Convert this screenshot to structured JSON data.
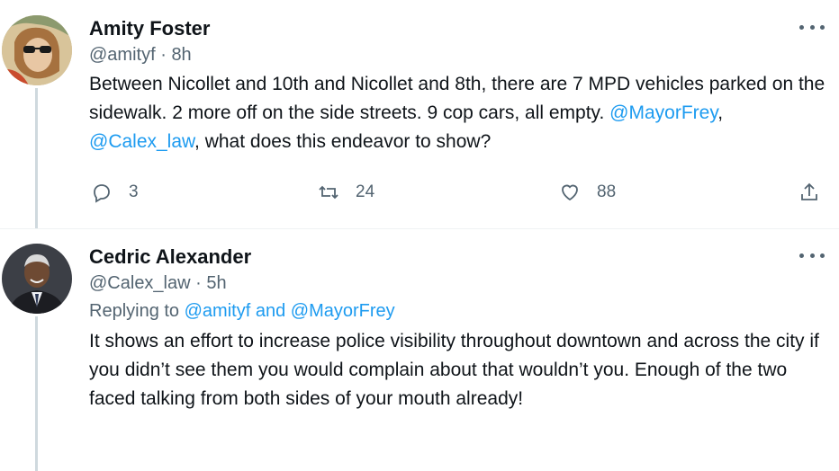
{
  "tweets": [
    {
      "name": "Amity Foster",
      "handle": "@amityf",
      "separator": "·",
      "time": "8h",
      "text_parts": [
        "Between Nicollet and 10th and Nicollet and 8th, there are 7 MPD vehicles parked on the sidewalk. 2 more off on the side streets. 9 cop cars, all empty. ",
        "@MayorFrey",
        ", ",
        "@Calex_law",
        ", what does this endeavor to show?"
      ],
      "reply_count": "3",
      "retweet_count": "24",
      "like_count": "88"
    },
    {
      "name": "Cedric Alexander",
      "handle": "@Calex_law",
      "separator": "·",
      "time": "5h",
      "replying_to_label": "Replying to ",
      "replying_to_users": [
        "@amityf",
        "@MayorFrey"
      ],
      "replying_to_and": " and ",
      "text": "It shows an effort to increase police visibility throughout downtown and across the city if you didn’t see them you would complain about that wouldn’t you. Enough of the two faced talking from both sides of your mouth already!"
    }
  ],
  "colors": {
    "link": "#1d9bf0",
    "secondary_text": "#536471",
    "primary_text": "#0f1419",
    "thread_line": "#cfd9de"
  },
  "icons": [
    "more-icon",
    "reply-icon",
    "retweet-icon",
    "like-icon",
    "share-icon"
  ]
}
